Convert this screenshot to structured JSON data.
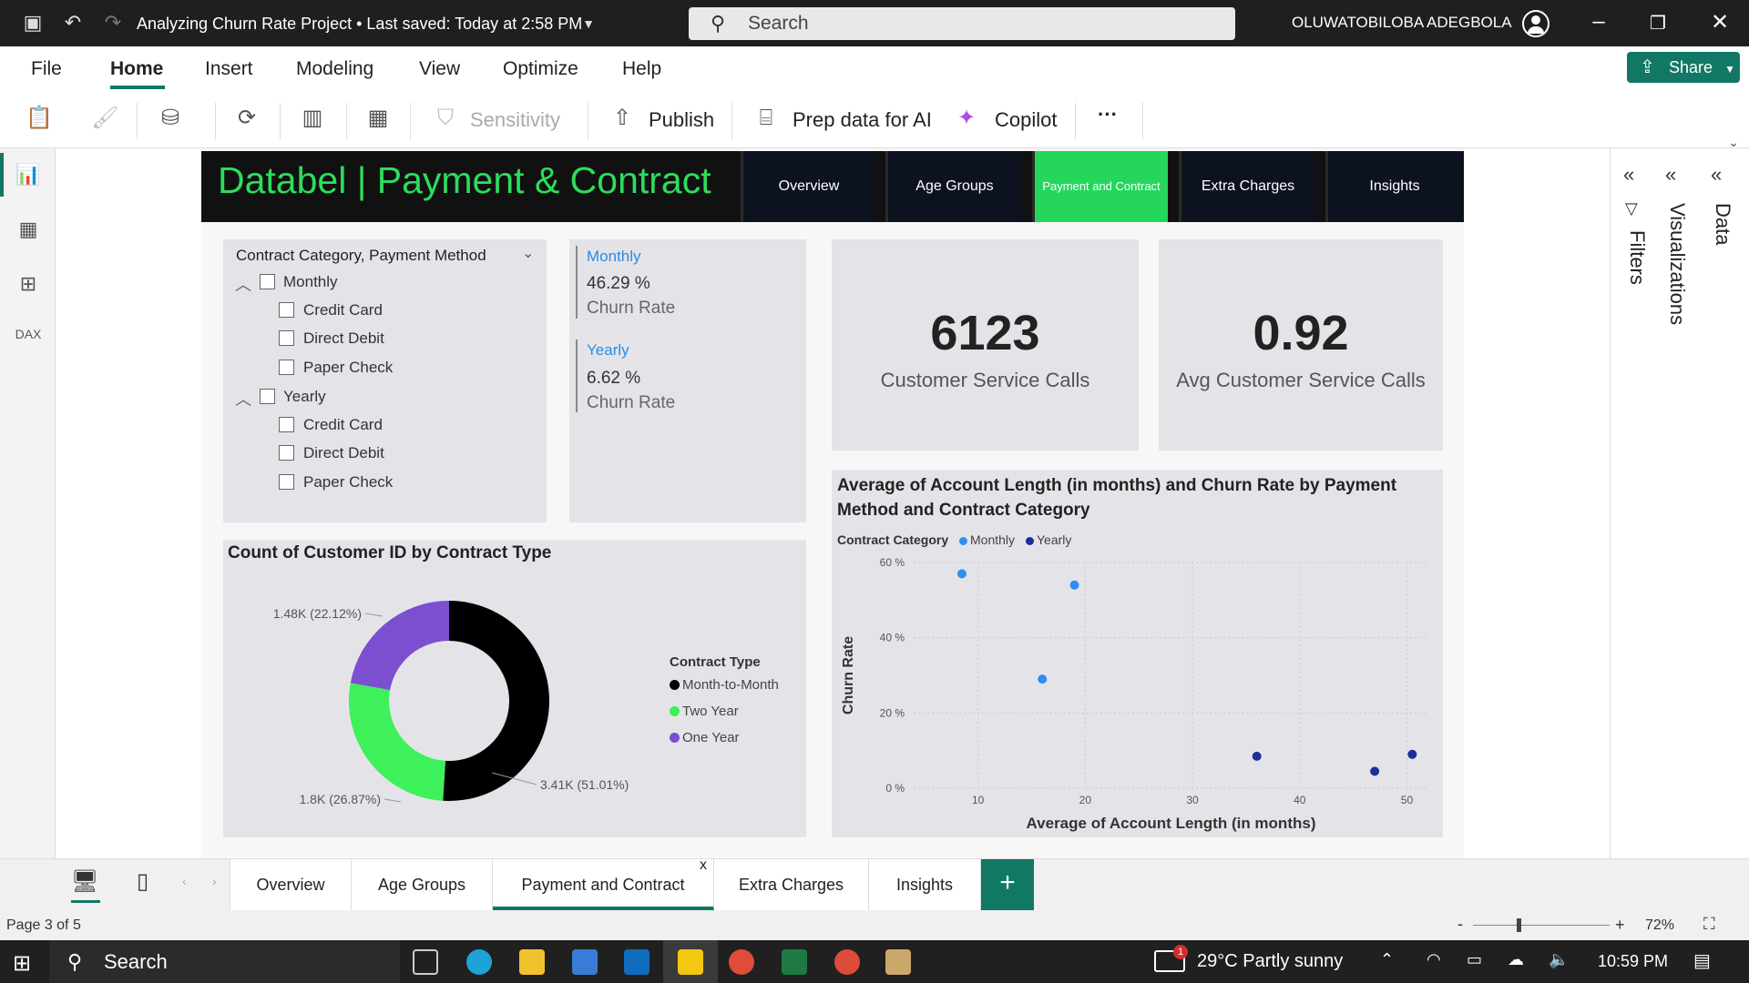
{
  "titlebar": {
    "title": "Analyzing Churn Rate Project • Last saved: Today at 2:58 PM",
    "search": "Search",
    "user": "OLUWATOBILOBA ADEGBOLA"
  },
  "menu": {
    "file": "File",
    "home": "Home",
    "insert": "Insert",
    "modeling": "Modeling",
    "view": "View",
    "optimize": "Optimize",
    "help": "Help",
    "share": "Share"
  },
  "toolbar": {
    "sensitivity": "Sensitivity",
    "publish": "Publish",
    "prep": "Prep data for AI",
    "copilot": "Copilot",
    "more": "···"
  },
  "report": {
    "title": "Databel | Payment & Contract",
    "nav": [
      "Overview",
      "Age Groups",
      "Payment and Contract",
      "Extra Charges",
      "Insights"
    ],
    "slicer": {
      "title": "Contract Category, Payment Method",
      "groups": [
        {
          "label": "Monthly",
          "items": [
            "Credit Card",
            "Direct Debit",
            "Paper Check"
          ]
        },
        {
          "label": "Yearly",
          "items": [
            "Credit Card",
            "Direct Debit",
            "Paper Check"
          ]
        }
      ]
    },
    "multicard": [
      {
        "label": "Monthly",
        "value": "46.29 %",
        "sub": "Churn Rate"
      },
      {
        "label": "Yearly",
        "value": "6.62 %",
        "sub": "Churn Rate"
      }
    ],
    "kpi1": {
      "value": "6123",
      "label": "Customer Service Calls"
    },
    "kpi2": {
      "value": "0.92",
      "label": "Avg Customer Service Calls"
    }
  },
  "chart_data": [
    {
      "type": "pie",
      "title": "Count of Customer ID by Contract Type",
      "legend_title": "Contract Type",
      "legend_position": "right",
      "series": [
        {
          "name": "Month-to-Month",
          "value": 3410,
          "label": "3.41K (51.01%)",
          "color": "#000000"
        },
        {
          "name": "Two Year",
          "value": 1800,
          "label": "1.8K (26.87%)",
          "color": "#3ef05a"
        },
        {
          "name": "One Year",
          "value": 1480,
          "label": "1.48K (22.12%)",
          "color": "#7b4fcf"
        }
      ]
    },
    {
      "type": "scatter",
      "title": "Average of Account Length (in months) and Churn Rate by Payment Method and Contract Category",
      "legend_title": "Contract Category",
      "xlabel": "Average of Account Length (in months)",
      "ylabel": "Churn Rate",
      "xlim": [
        4,
        52
      ],
      "ylim": [
        0,
        60
      ],
      "xticks": [
        10,
        20,
        30,
        40,
        50
      ],
      "yticks": [
        "0 %",
        "20 %",
        "40 %",
        "60 %"
      ],
      "series": [
        {
          "name": "Monthly",
          "color": "#2f8ef0",
          "points": [
            [
              8.5,
              57
            ],
            [
              19,
              54
            ],
            [
              16,
              29
            ]
          ]
        },
        {
          "name": "Yearly",
          "color": "#1c2f9c",
          "points": [
            [
              36,
              8.5
            ],
            [
              47,
              4.5
            ],
            [
              50.5,
              9
            ]
          ]
        }
      ]
    }
  ],
  "panes": {
    "filters": "Filters",
    "visualizations": "Visualizations",
    "data": "Data"
  },
  "tabs": {
    "items": [
      "Overview",
      "Age Groups",
      "Payment and Contract",
      "Extra Charges",
      "Insights"
    ],
    "close": "x",
    "add": "+"
  },
  "status": {
    "page": "Page 3 of 5",
    "zoom": "72%"
  },
  "taskbar": {
    "search": "Search",
    "weather": "29°C  Partly sunny",
    "time": "10:59 PM",
    "badge": "1"
  }
}
